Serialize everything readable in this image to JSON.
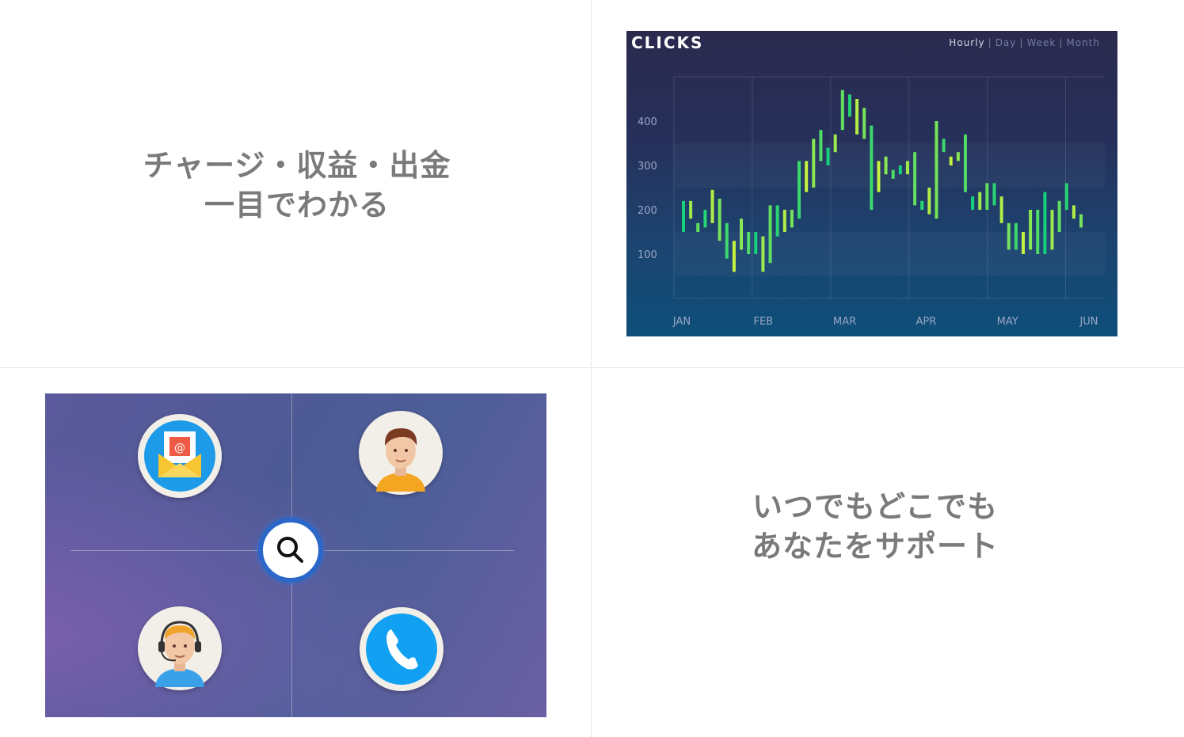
{
  "captions": {
    "charges": [
      "チャージ・収益・出金",
      "一目でわかる"
    ],
    "support": [
      "いつでもどこでも",
      "あなたをサポート"
    ]
  },
  "chart_data": {
    "type": "candlestick",
    "title": "CLICKS",
    "range_tabs": [
      "Hourly",
      "Day",
      "Week",
      "Month"
    ],
    "active_tab": "Hourly",
    "x_labels": [
      "JAN",
      "FEB",
      "MAR",
      "APR",
      "MAY",
      "JUN"
    ],
    "y_ticks": [
      100,
      200,
      300,
      400
    ],
    "ylim": [
      0,
      500
    ],
    "grid": true,
    "candles": [
      [
        150,
        220
      ],
      [
        180,
        220
      ],
      [
        150,
        170
      ],
      [
        160,
        200
      ],
      [
        170,
        245
      ],
      [
        130,
        225
      ],
      [
        90,
        170
      ],
      [
        60,
        130
      ],
      [
        110,
        180
      ],
      [
        100,
        150
      ],
      [
        100,
        150
      ],
      [
        60,
        140
      ],
      [
        80,
        210
      ],
      [
        140,
        210
      ],
      [
        150,
        200
      ],
      [
        160,
        200
      ],
      [
        180,
        310
      ],
      [
        240,
        310
      ],
      [
        250,
        360
      ],
      [
        310,
        380
      ],
      [
        300,
        340
      ],
      [
        330,
        370
      ],
      [
        380,
        470
      ],
      [
        410,
        460
      ],
      [
        370,
        450
      ],
      [
        360,
        430
      ],
      [
        200,
        390
      ],
      [
        240,
        310
      ],
      [
        280,
        320
      ],
      [
        270,
        290
      ],
      [
        280,
        300
      ],
      [
        280,
        310
      ],
      [
        210,
        330
      ],
      [
        200,
        220
      ],
      [
        190,
        250
      ],
      [
        180,
        400
      ],
      [
        330,
        360
      ],
      [
        300,
        320
      ],
      [
        310,
        330
      ],
      [
        240,
        370
      ],
      [
        200,
        230
      ],
      [
        200,
        240
      ],
      [
        200,
        260
      ],
      [
        210,
        260
      ],
      [
        170,
        230
      ],
      [
        110,
        170
      ],
      [
        110,
        170
      ],
      [
        100,
        150
      ],
      [
        110,
        200
      ],
      [
        100,
        200
      ],
      [
        100,
        240
      ],
      [
        110,
        200
      ],
      [
        150,
        220
      ],
      [
        200,
        260
      ],
      [
        180,
        210
      ],
      [
        160,
        190
      ]
    ],
    "colors": {
      "low": "#14d17a",
      "high": "#d9f53a"
    }
  },
  "support": {
    "icons": [
      "mail-icon",
      "user-avatar-icon",
      "search-icon",
      "support-agent-icon",
      "phone-icon"
    ],
    "mail_symbol": "@"
  }
}
